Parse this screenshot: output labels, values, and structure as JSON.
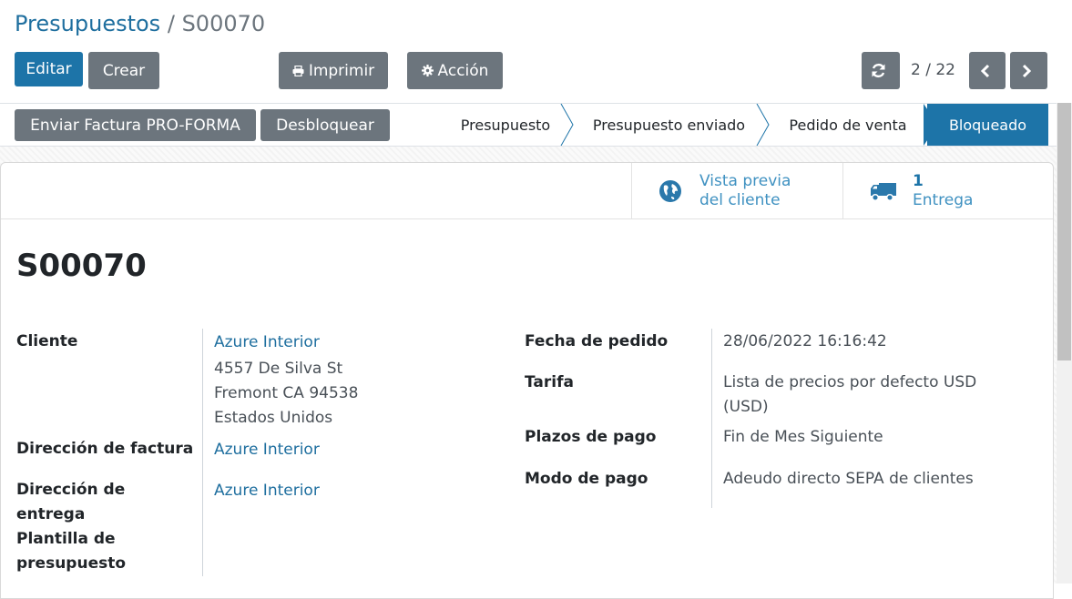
{
  "breadcrumb": {
    "parent": "Presupuestos",
    "separator": "/",
    "current": "S00070"
  },
  "buttons": {
    "edit": "Editar",
    "create": "Crear",
    "print": "Imprimir",
    "action": "Acción"
  },
  "pager": {
    "value": "2 / 22"
  },
  "statusbar": {
    "buttons": {
      "proforma": "Enviar Factura PRO-FORMA",
      "unlock": "Desbloquear"
    },
    "stages": [
      "Presupuesto",
      "Presupuesto enviado",
      "Pedido de venta",
      "Bloqueado"
    ],
    "active_stage": "Bloqueado"
  },
  "smart_buttons": {
    "preview": {
      "line1": "Vista previa",
      "line2": "del cliente"
    },
    "delivery": {
      "count": "1",
      "label": "Entrega"
    }
  },
  "record": {
    "name": "S00070",
    "left": {
      "customer_label": "Cliente",
      "customer_name": "Azure Interior",
      "address_lines": [
        "4557 De Silva St",
        "Fremont CA 94538",
        "Estados Unidos"
      ],
      "invoice_addr_label": "Dirección de factura",
      "invoice_addr": "Azure Interior",
      "delivery_addr_label_1": "Dirección de",
      "delivery_addr_label_2": "entrega",
      "delivery_addr": "Azure Interior",
      "template_label_1": "Plantilla de",
      "template_label_2": "presupuesto"
    },
    "right": {
      "order_date_label": "Fecha de pedido",
      "order_date": "28/06/2022 16:16:42",
      "pricelist_label": "Tarifa",
      "pricelist_1": "Lista de precios por defecto USD",
      "pricelist_2": "(USD)",
      "payment_terms_label": "Plazos de pago",
      "payment_terms": "Fin de Mes Siguiente",
      "payment_mode_label": "Modo de pago",
      "payment_mode": "Adeudo directo SEPA de clientes"
    }
  },
  "colors": {
    "primary": "#1d74a8",
    "secondary": "#6c757d",
    "link": "#1f6f9f"
  }
}
